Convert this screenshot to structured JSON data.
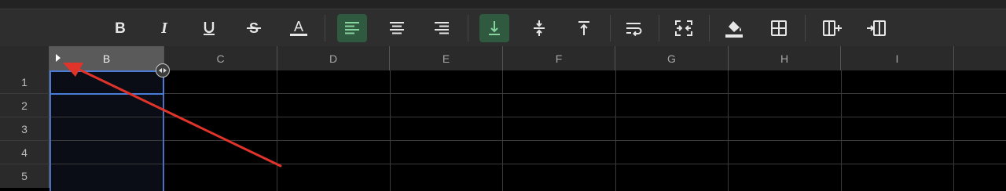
{
  "toolbar": {
    "buttons": [
      {
        "id": "bold",
        "icon": "bold-icon"
      },
      {
        "id": "italic",
        "icon": "italic-icon"
      },
      {
        "id": "underline",
        "icon": "underline-icon"
      },
      {
        "id": "strikethrough",
        "icon": "strikethrough-icon"
      },
      {
        "id": "text-color",
        "icon": "text-color-icon"
      },
      {
        "id": "align-left",
        "icon": "align-left-icon",
        "active": true
      },
      {
        "id": "align-center",
        "icon": "align-center-icon"
      },
      {
        "id": "align-right",
        "icon": "align-right-icon"
      },
      {
        "id": "valign-bottom",
        "icon": "valign-bottom-icon",
        "active": true
      },
      {
        "id": "valign-middle",
        "icon": "valign-middle-icon"
      },
      {
        "id": "valign-top",
        "icon": "valign-top-icon"
      },
      {
        "id": "wrap-text",
        "icon": "wrap-text-icon"
      },
      {
        "id": "merge-cells",
        "icon": "merge-cells-icon"
      },
      {
        "id": "fill-color",
        "icon": "fill-color-icon"
      },
      {
        "id": "borders",
        "icon": "borders-icon"
      },
      {
        "id": "insert-column-left",
        "icon": "insert-column-left-icon"
      },
      {
        "id": "insert-column-right",
        "icon": "insert-column-right-icon"
      }
    ]
  },
  "columns": [
    "B",
    "C",
    "D",
    "E",
    "F",
    "G",
    "H",
    "I"
  ],
  "selected_column": "B",
  "rows": [
    "1",
    "2",
    "3",
    "4",
    "5"
  ],
  "colors": {
    "active_button": "#2f5a3f",
    "selection_border": "#4a7bd6",
    "annotation_arrow": "#e0342a"
  }
}
